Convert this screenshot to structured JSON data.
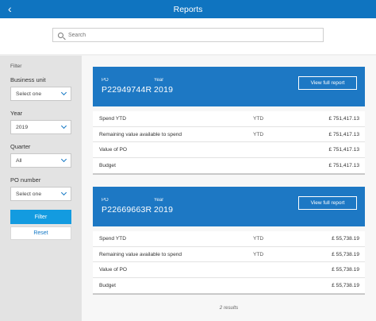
{
  "header": {
    "title": "Reports",
    "back_icon": "chevron-left-icon"
  },
  "search": {
    "placeholder": "Search",
    "icon": "search-icon"
  },
  "filter": {
    "title": "Filter",
    "business_unit": {
      "label": "Business unit",
      "value": "Select one"
    },
    "year": {
      "label": "Year",
      "value": "2019"
    },
    "quarter": {
      "label": "Quarter",
      "value": "All"
    },
    "po_number": {
      "label": "PO number",
      "value": "Select one"
    },
    "filter_button": "Filter",
    "reset_button": "Reset"
  },
  "cards": [
    {
      "po_label": "PO",
      "po": "P22949744R",
      "year_label": "Year",
      "year": "2019",
      "view_button": "View full report",
      "rows": [
        {
          "label": "Spend YTD",
          "tag": "YTD",
          "value": "£ 751,417.13"
        },
        {
          "label": "Remaining value available to spend",
          "tag": "YTD",
          "value": "£ 751,417.13"
        },
        {
          "label": "Value of PO",
          "tag": "",
          "value": "£ 751,417.13"
        },
        {
          "label": "Budget",
          "tag": "",
          "value": "£ 751,417.13"
        }
      ]
    },
    {
      "po_label": "PO",
      "po": "P22669663R",
      "year_label": "Year",
      "year": "2019",
      "view_button": "View full report",
      "rows": [
        {
          "label": "Spend YTD",
          "tag": "YTD",
          "value": "£ 55,738.19"
        },
        {
          "label": "Remaining value available to spend",
          "tag": "YTD",
          "value": "£ 55,738.19"
        },
        {
          "label": "Value of PO",
          "tag": "",
          "value": "£ 55,738.19"
        },
        {
          "label": "Budget",
          "tag": "",
          "value": "£ 55,738.19"
        }
      ]
    }
  ],
  "results_text": "2 results",
  "colors": {
    "header": "#0f74c0",
    "card_header": "#1d78c4",
    "filter_button": "#139be0"
  }
}
